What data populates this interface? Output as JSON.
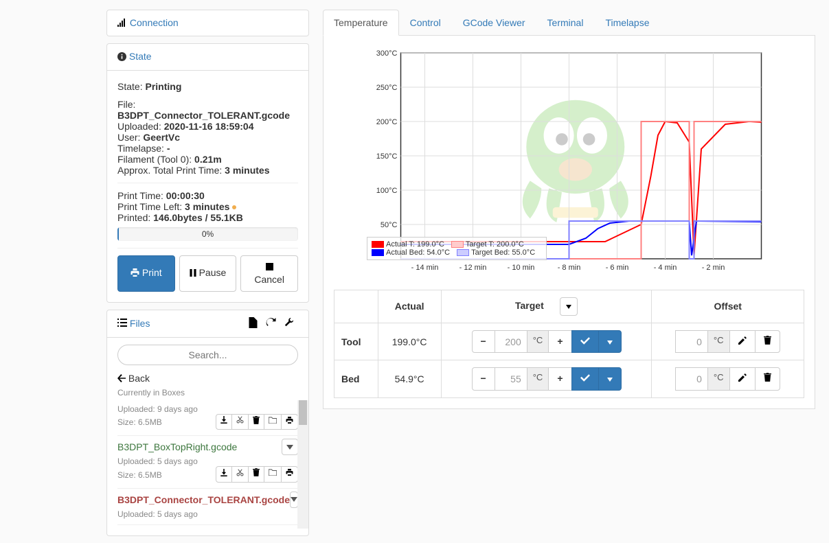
{
  "connection": {
    "title": "Connection"
  },
  "state": {
    "title": "State",
    "label_state": "State:",
    "state": "Printing",
    "label_file": "File:",
    "file": "B3DPT_Connector_TOLERANT.gcode",
    "label_uploaded": "Uploaded:",
    "uploaded": "2020-11-16 18:59:04",
    "label_user": "User:",
    "user": "GeertVc",
    "label_timelapse": "Timelapse:",
    "timelapse": "-",
    "label_filament": "Filament (Tool 0):",
    "filament": "0.21m",
    "label_total": "Approx. Total Print Time:",
    "total": "3 minutes",
    "label_ptime": "Print Time:",
    "ptime": "00:00:30",
    "label_ptimeleft": "Print Time Left:",
    "ptimeleft": "3 minutes",
    "label_printed": "Printed:",
    "printed": "146.0bytes / 55.1KB",
    "progress_text": "0%",
    "btn_print": "Print",
    "btn_pause": "Pause",
    "btn_cancel": "Cancel"
  },
  "files": {
    "title": "Files",
    "search_placeholder": "Search...",
    "back": "Back",
    "currently": "Currently in Boxes",
    "items": [
      {
        "name": "",
        "uploaded": "Uploaded: 9 days ago",
        "size": "Size: 6.5MB",
        "variant": "faded"
      },
      {
        "name": "B3DPT_BoxTopRight.gcode",
        "uploaded": "Uploaded: 5 days ago",
        "size": "Size: 6.5MB",
        "variant": "success"
      },
      {
        "name": "B3DPT_Connector_TOLERANT.gcode",
        "uploaded": "Uploaded: 5 days ago",
        "size": "",
        "variant": "active"
      }
    ]
  },
  "tabs": {
    "items": [
      "Temperature",
      "Control",
      "GCode Viewer",
      "Terminal",
      "Timelapse"
    ],
    "active": 0
  },
  "chart_data": {
    "type": "line",
    "xlabel": "",
    "ylabel": "",
    "x_ticks": [
      "- 14 min",
      "- 12 min",
      "- 10 min",
      "- 8 min",
      "- 6 min",
      "- 4 min",
      "- 2 min"
    ],
    "y_ticks": [
      "50°C",
      "100°C",
      "150°C",
      "200°C",
      "250°C",
      "300°C"
    ],
    "ylim": [
      0,
      300
    ],
    "xlim_min": [
      -15,
      0
    ],
    "legend": [
      {
        "label": "Actual T: 199.0°C",
        "color": "#ff0000",
        "fill": "#ff0000"
      },
      {
        "label": "Target T: 200.0°C",
        "color": "#ff8080",
        "fill": "#ffcccc"
      },
      {
        "label": "Actual Bed: 54.0°C",
        "color": "#0000ff",
        "fill": "#0000ff"
      },
      {
        "label": "Target Bed: 55.0°C",
        "color": "#8080ff",
        "fill": "#ccccff"
      }
    ],
    "series": [
      {
        "name": "Actual T",
        "color": "#ff0000",
        "points_min_degc": [
          [
            -15,
            25
          ],
          [
            -7,
            25
          ],
          [
            -6.5,
            25
          ],
          [
            -5,
            50
          ],
          [
            -4.6,
            120
          ],
          [
            -4.3,
            180
          ],
          [
            -4.0,
            200
          ],
          [
            -3.5,
            198
          ],
          [
            -3,
            170
          ],
          [
            -2.8,
            5
          ],
          [
            -2.5,
            160
          ],
          [
            -1.5,
            196
          ],
          [
            -0.5,
            200
          ],
          [
            0,
            199
          ]
        ]
      },
      {
        "name": "Target T",
        "color": "#ff8080",
        "points_min_degc": [
          [
            -15,
            0
          ],
          [
            -5,
            0
          ],
          [
            -5,
            200
          ],
          [
            -3,
            200
          ],
          [
            -3,
            0
          ],
          [
            -2.8,
            0
          ],
          [
            -2.8,
            200
          ],
          [
            0,
            200
          ]
        ]
      },
      {
        "name": "Actual Bed",
        "color": "#0000ff",
        "points_min_degc": [
          [
            -15,
            21
          ],
          [
            -8,
            21
          ],
          [
            -7.3,
            30
          ],
          [
            -6.8,
            44
          ],
          [
            -6.3,
            52
          ],
          [
            -5.5,
            55
          ],
          [
            -3,
            55
          ],
          [
            -2.9,
            5
          ],
          [
            -2.7,
            55
          ],
          [
            0,
            54
          ]
        ]
      },
      {
        "name": "Target Bed",
        "color": "#8080ff",
        "points_min_degc": [
          [
            -15,
            0
          ],
          [
            -8,
            0
          ],
          [
            -8,
            55
          ],
          [
            -3,
            55
          ],
          [
            -3,
            0
          ],
          [
            -2.8,
            0
          ],
          [
            -2.8,
            55
          ],
          [
            0,
            55
          ]
        ]
      }
    ]
  },
  "temp": {
    "th_actual": "Actual",
    "th_target": "Target",
    "th_offset": "Offset",
    "rows": [
      {
        "label": "Tool",
        "actual": "199.0°C",
        "target": "200",
        "offset": "0"
      },
      {
        "label": "Bed",
        "actual": "54.9°C",
        "target": "55",
        "offset": "0"
      }
    ],
    "unit": "°C"
  }
}
